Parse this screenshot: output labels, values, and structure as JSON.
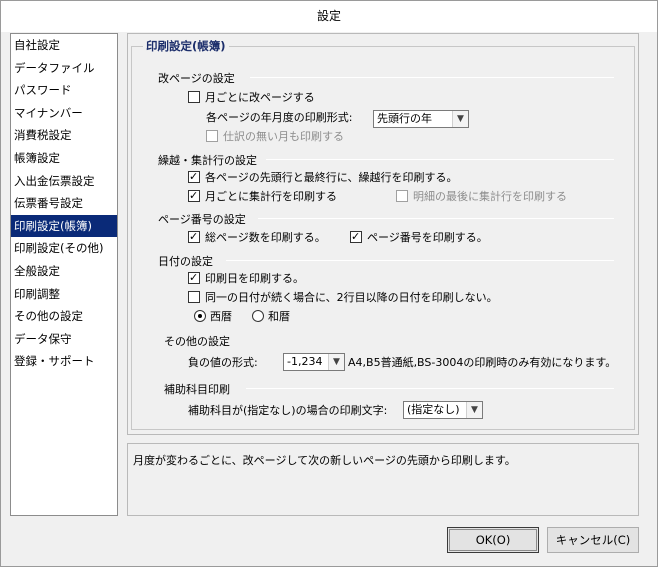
{
  "window": {
    "title": "設定"
  },
  "sidebar": {
    "items": [
      {
        "label": "自社設定"
      },
      {
        "label": "データファイル"
      },
      {
        "label": "パスワード"
      },
      {
        "label": "マイナンバー"
      },
      {
        "label": "消費税設定"
      },
      {
        "label": "帳簿設定"
      },
      {
        "label": "入出金伝票設定"
      },
      {
        "label": "伝票番号設定"
      },
      {
        "label": "印刷設定(帳簿)",
        "active": true
      },
      {
        "label": "印刷設定(その他)"
      },
      {
        "label": "全般設定"
      },
      {
        "label": "印刷調整"
      },
      {
        "label": "その他の設定"
      },
      {
        "label": "データ保守"
      },
      {
        "label": "登録・サポート"
      }
    ]
  },
  "panel": {
    "title": "印刷設定(帳簿)",
    "page_break": {
      "title": "改ページの設定",
      "monthly_break": {
        "label": "月ごとに改ページする",
        "checked": false
      },
      "format_label": "各ページの年月度の印刷形式:",
      "format_value": "先頭行の年",
      "print_empty_months": {
        "label": "仕訳の無い月も印刷する",
        "checked": false,
        "disabled": true
      }
    },
    "carryover": {
      "title": "繰越・集計行の設定",
      "print_carry": {
        "label": "各ページの先頭行と最終行に、繰越行を印刷する。",
        "checked": true
      },
      "monthly_total": {
        "label": "月ごとに集計行を印刷する",
        "checked": true
      },
      "detail_last_total": {
        "label": "明細の最後に集計行を印刷する",
        "checked": false,
        "disabled": true
      }
    },
    "page_number": {
      "title": "ページ番号の設定",
      "total_pages": {
        "label": "総ページ数を印刷する。",
        "checked": true
      },
      "page_no": {
        "label": "ページ番号を印刷する。",
        "checked": true
      }
    },
    "date": {
      "title": "日付の設定",
      "print_date": {
        "label": "印刷日を印刷する。",
        "checked": true
      },
      "same_date": {
        "label": "同一の日付が続く場合に、2行目以降の日付を印刷しない。",
        "checked": false
      },
      "seireki": {
        "label": "西暦",
        "selected": true
      },
      "wareki": {
        "label": "和暦",
        "selected": false
      }
    },
    "other": {
      "title": "その他の設定",
      "negative_label": "負の値の形式:",
      "negative_value": "-1,234",
      "negative_note": "A4,B5普通紙,BS-3004の印刷時のみ有効になります。"
    },
    "sub_account": {
      "title": "補助科目印刷",
      "label": "補助科目が(指定なし)の場合の印刷文字:",
      "value": "(指定なし)"
    }
  },
  "description": "月度が変わるごとに、改ページして次の新しいページの先頭から印刷します。",
  "buttons": {
    "ok": "OK(O)",
    "cancel": "キャンセル(C)"
  }
}
